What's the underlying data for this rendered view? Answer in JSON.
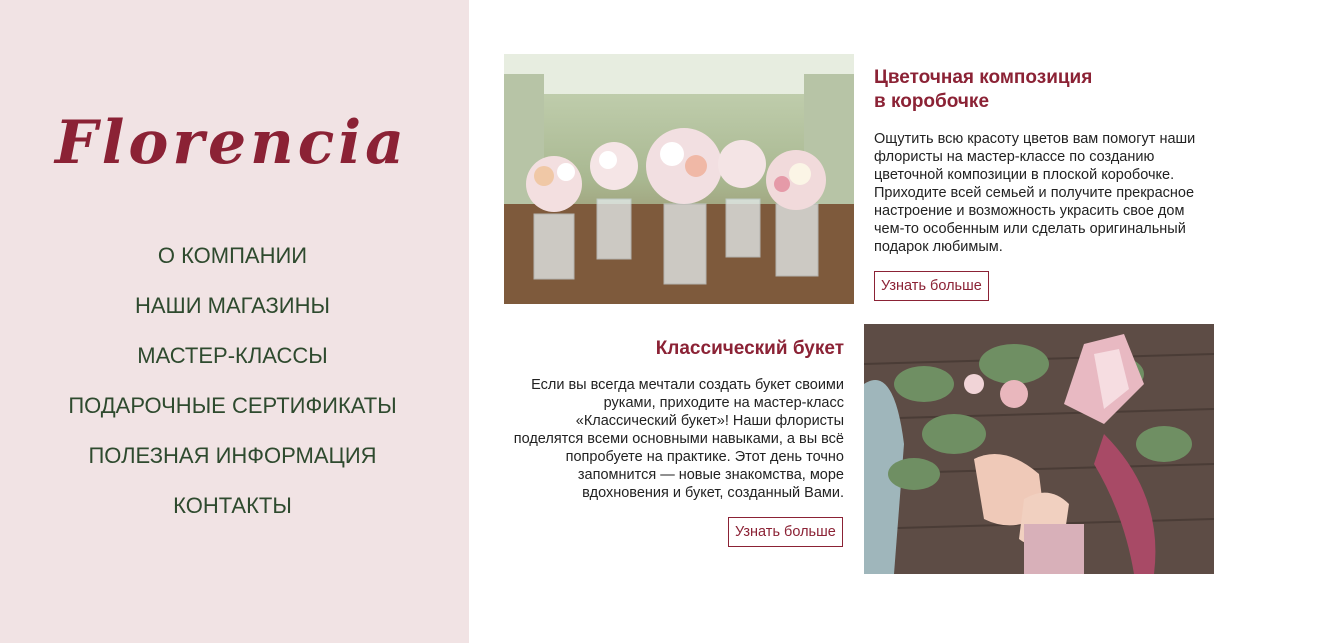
{
  "brand": {
    "logo": "Florencia"
  },
  "nav": {
    "items": [
      "О КОМПАНИИ",
      "НАШИ МАГАЗИНЫ",
      "МАСТЕР-КЛАССЫ",
      "ПОДАРОЧНЫЕ СЕРТИФИКАТЫ",
      "ПОЛЕЗНАЯ ИНФОРМАЦИЯ",
      "КОНТАКТЫ"
    ]
  },
  "cards": [
    {
      "title_line1": "Цветочная композиция",
      "title_line2": "в коробочке",
      "description": "Ощутить всю красоту цветов вам помогут наши флористы на мастер-классе по созданию цветочной композиции в плоской коробочке. Приходите всей семьей и получите прекрасное настроение и возможность украсить свое дом чем-то особенным или сделать оригинальный подарок любимым.",
      "button": "Узнать больше"
    },
    {
      "title_line1": "Классический букет",
      "description": "Если вы всегда мечтали создать букет своими руками, приходите на мастер-класс «Классический букет»! Наши флористы поделятся всеми основными навыками, а вы всё попробуете на практике. Этот день точно запомнится — новые знакомства, море вдохновения и букет, созданный Вами.",
      "button": "Узнать больше"
    }
  ],
  "colors": {
    "accent": "#8b2235",
    "nav_text": "#2e4a2e",
    "sidebar_bg": "#f1e3e4"
  }
}
